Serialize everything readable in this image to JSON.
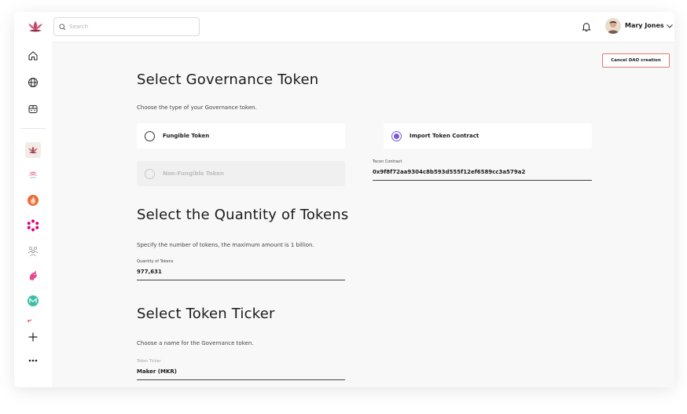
{
  "search": {
    "placeholder": "Search"
  },
  "user": {
    "name": "Mary Jones"
  },
  "colors": {
    "accent": "#7b5bd3",
    "cancel_border": "#e2776e",
    "background": "#f8f8f8"
  },
  "sidebar": {
    "nav": [
      {
        "name": "home-icon"
      },
      {
        "name": "globe-icon"
      },
      {
        "name": "robot-icon"
      }
    ],
    "daos": [
      {
        "name": "dao-lotus-icon",
        "color": "#b5485b"
      },
      {
        "name": "dao-wave-icon",
        "color": "#e8588a"
      },
      {
        "name": "dao-flame-icon",
        "color": "#f06b3a"
      },
      {
        "name": "dao-ring-icon",
        "color": "#e6007a"
      },
      {
        "name": "dao-people-icon",
        "color": "#9a9a9a"
      },
      {
        "name": "dao-unicorn-icon",
        "color": "#e64a8e"
      },
      {
        "name": "dao-monero-icon",
        "color": "#3cc0a4"
      }
    ],
    "add": "+",
    "more": "•••"
  },
  "main": {
    "cancel_label": "Cancel DAO creation",
    "governance": {
      "title": "Select Governance Token",
      "description": "Choose the type of your Governance token.",
      "options": [
        {
          "label": "Fungible Token",
          "selected": false,
          "disabled": false
        },
        {
          "label": "Import Token Contract",
          "selected": true,
          "disabled": false
        },
        {
          "label": "Non-Fungible Token",
          "selected": false,
          "disabled": true
        }
      ],
      "contract_label": "Tocon Contract",
      "contract_value": "0x9f8f72aa9304c8b593d555f12ef6589cc3a579a2"
    },
    "quantity": {
      "title": "Select the Quantity of Tokens",
      "description": "Specify the number of tokens, the maximum amount is 1 billion.",
      "field_label": "Quantity of Tokens",
      "field_value": "977,631"
    },
    "ticker": {
      "title": "Select Token Ticker",
      "description": "Choose a name for the Governance token.",
      "field_label": "Token Ticker",
      "field_value": "Maker (MKR)"
    }
  }
}
